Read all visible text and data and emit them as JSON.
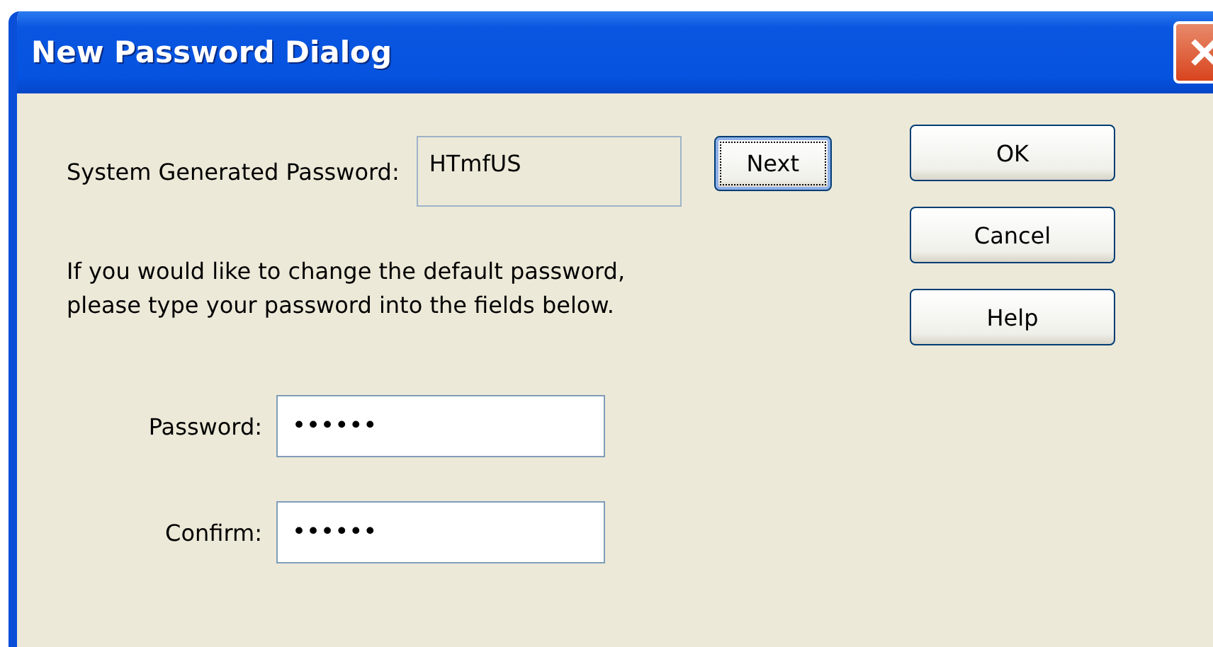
{
  "window": {
    "title": "New Password Dialog"
  },
  "generated": {
    "label": "System Generated Password:",
    "value": "HTmfUS"
  },
  "next_button": {
    "label": "Next",
    "focused": true
  },
  "instructions": "If you would like to change the default password,\nplease type your password into the fields below.",
  "fields": [
    {
      "label": "Password:",
      "value": "••••••"
    },
    {
      "label": "Confirm:",
      "value": "••••••"
    }
  ],
  "buttons": [
    "OK",
    "Cancel",
    "Help"
  ]
}
